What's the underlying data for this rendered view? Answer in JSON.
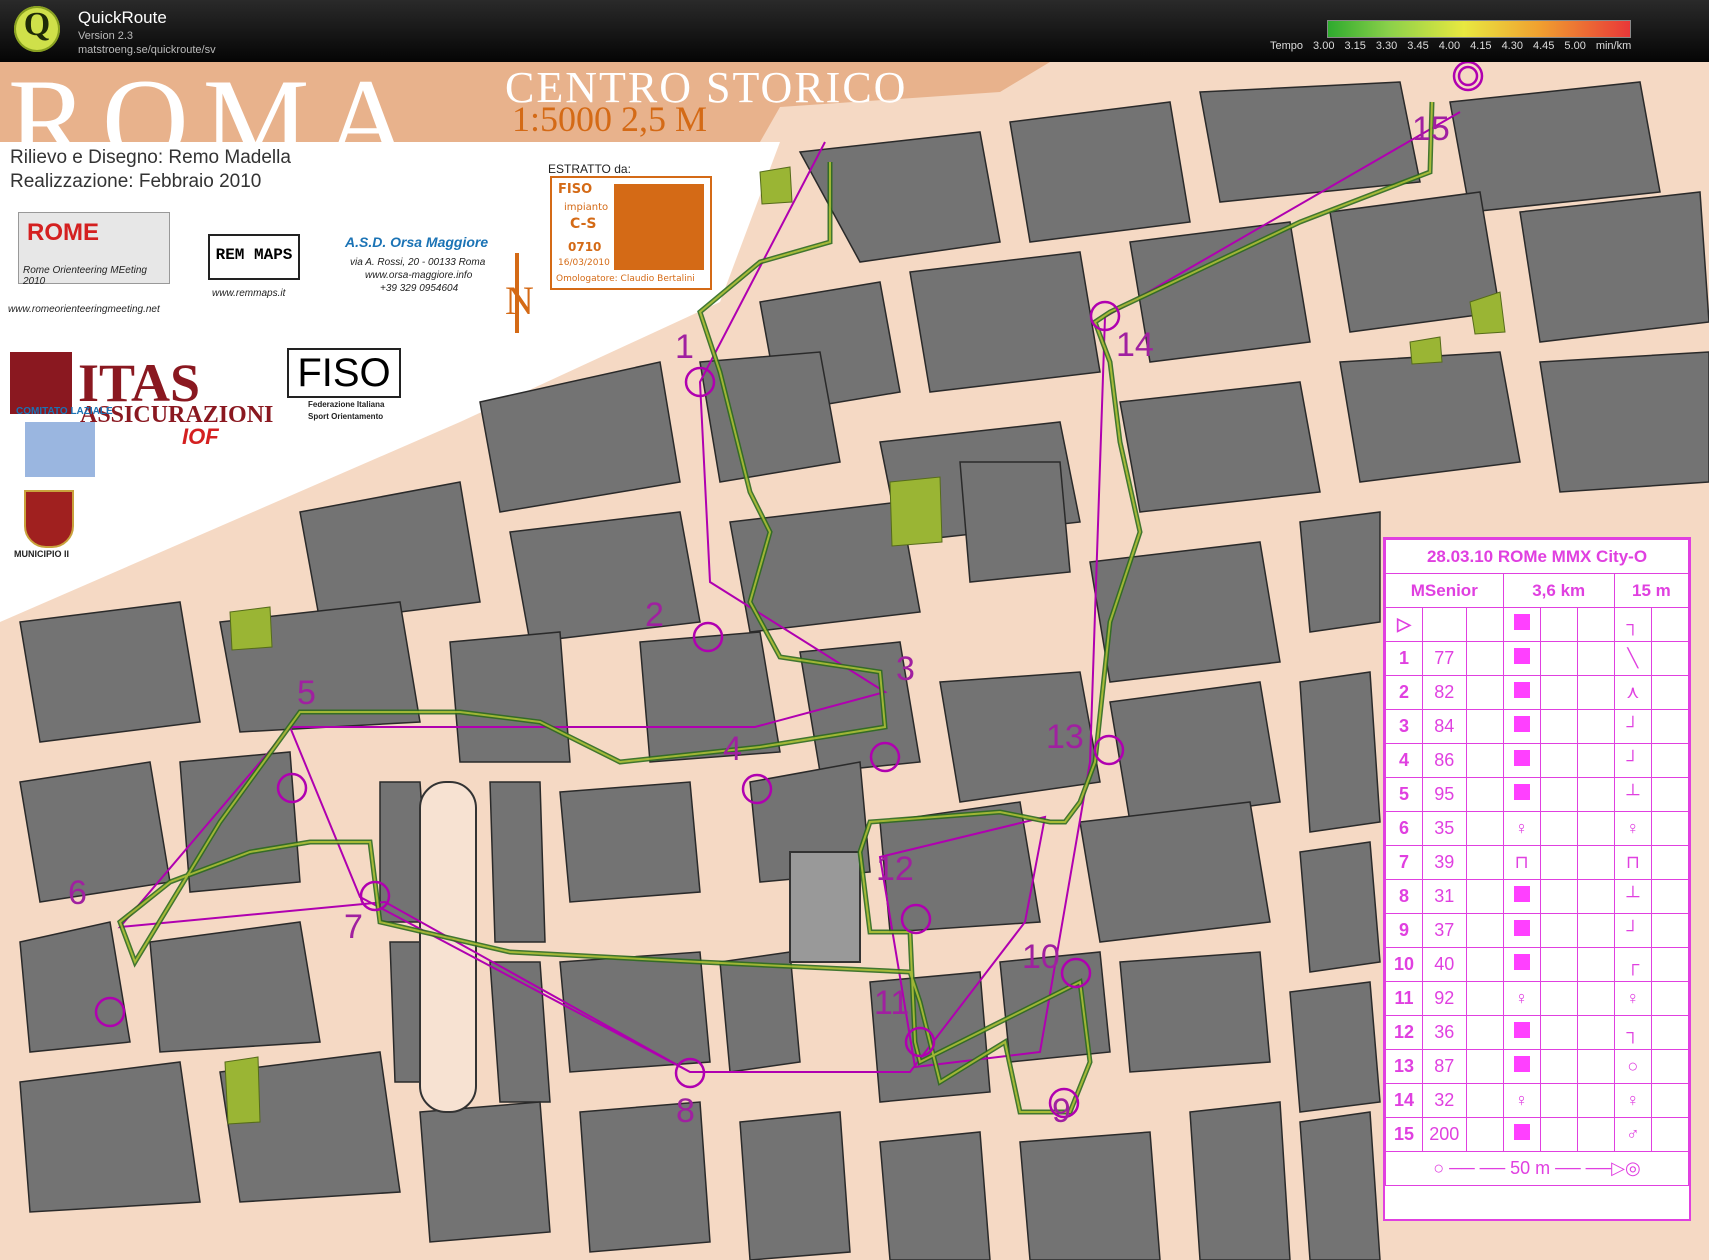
{
  "app": {
    "name": "QuickRoute",
    "version": "Version 2.3",
    "url": "matstroeng.se/quickroute/sv",
    "logo_letter": "Q"
  },
  "pace_legend": {
    "label": "Tempo",
    "ticks": [
      "3.00",
      "3.15",
      "3.30",
      "3.45",
      "4.00",
      "4.15",
      "4.30",
      "4.45",
      "5.00"
    ],
    "unit": "min/km",
    "colors": [
      "#2eaa2e",
      "#e8e840",
      "#e83838"
    ]
  },
  "map_header": {
    "title": "ROMA",
    "subtitle": "CENTRO STORICO",
    "scale": "1:5000  2,5 M",
    "credit_line1": "Rilievo e Disegno: Remo Madella",
    "credit_line2": "Realizzazione: Febbraio 2010",
    "club_name": "A.S.D. Orsa Maggiore",
    "club_address": "via A. Rossi, 20 - 00133 Roma",
    "club_web": "www.orsa-maggiore.info",
    "club_phone": "+39 329 0954604",
    "rome_event": "Rome Orienteering MEeting 2010",
    "rome_web": "www.romeorienteeringmeeting.net",
    "remmaps_logo": "REM MAPS",
    "remmaps_web": "www.remmaps.it",
    "itas_title": "ITAS",
    "itas_sub": "ASSICURAZIONI",
    "fiso_logo": "FISO",
    "fiso_sub1": "Federazione Italiana",
    "fiso_sub2": "Sport Orientamento",
    "comitato": "COMITATO LAZIALE",
    "iof": "IOF",
    "municipio": "MUNICIPIO II",
    "north_letter": "N"
  },
  "estratto": {
    "label": "ESTRATTO da:",
    "org": "FISO",
    "impianto": "impianto",
    "code": "C-S",
    "number": "0710",
    "date": "16/03/2010",
    "omologatore": "Omologatore:  Claudio Bertalini"
  },
  "course": {
    "title": "28.03.10 ROMe MMX City-O",
    "category": "MSenior",
    "length": "3,6 km",
    "climb": "15 m",
    "finish_distance": "50 m",
    "controls": [
      {
        "n": "1",
        "code": "77"
      },
      {
        "n": "2",
        "code": "82"
      },
      {
        "n": "3",
        "code": "84"
      },
      {
        "n": "4",
        "code": "86"
      },
      {
        "n": "5",
        "code": "95"
      },
      {
        "n": "6",
        "code": "35"
      },
      {
        "n": "7",
        "code": "39"
      },
      {
        "n": "8",
        "code": "31"
      },
      {
        "n": "9",
        "code": "37"
      },
      {
        "n": "10",
        "code": "40"
      },
      {
        "n": "11",
        "code": "92"
      },
      {
        "n": "12",
        "code": "36"
      },
      {
        "n": "13",
        "code": "87"
      },
      {
        "n": "14",
        "code": "32"
      },
      {
        "n": "15",
        "code": "200"
      }
    ]
  },
  "map_labels": {
    "c1": "1",
    "c2": "2",
    "c3": "3",
    "c4": "4",
    "c5": "5",
    "c6": "6",
    "c7": "7",
    "c8": "8",
    "c9": "9",
    "c10": "10",
    "c11": "11",
    "c12": "12",
    "c13": "13",
    "c14": "14",
    "c15": "15"
  }
}
